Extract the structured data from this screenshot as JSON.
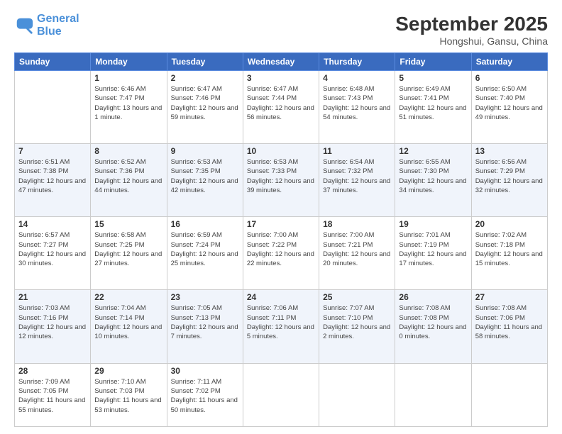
{
  "header": {
    "logo_line1": "General",
    "logo_line2": "Blue",
    "month": "September 2025",
    "location": "Hongshui, Gansu, China"
  },
  "weekdays": [
    "Sunday",
    "Monday",
    "Tuesday",
    "Wednesday",
    "Thursday",
    "Friday",
    "Saturday"
  ],
  "weeks": [
    [
      null,
      {
        "day": 1,
        "sunrise": "6:46 AM",
        "sunset": "7:47 PM",
        "daylight": "13 hours and 1 minute."
      },
      {
        "day": 2,
        "sunrise": "6:47 AM",
        "sunset": "7:46 PM",
        "daylight": "12 hours and 59 minutes."
      },
      {
        "day": 3,
        "sunrise": "6:47 AM",
        "sunset": "7:44 PM",
        "daylight": "12 hours and 56 minutes."
      },
      {
        "day": 4,
        "sunrise": "6:48 AM",
        "sunset": "7:43 PM",
        "daylight": "12 hours and 54 minutes."
      },
      {
        "day": 5,
        "sunrise": "6:49 AM",
        "sunset": "7:41 PM",
        "daylight": "12 hours and 51 minutes."
      },
      {
        "day": 6,
        "sunrise": "6:50 AM",
        "sunset": "7:40 PM",
        "daylight": "12 hours and 49 minutes."
      }
    ],
    [
      {
        "day": 7,
        "sunrise": "6:51 AM",
        "sunset": "7:38 PM",
        "daylight": "12 hours and 47 minutes."
      },
      {
        "day": 8,
        "sunrise": "6:52 AM",
        "sunset": "7:36 PM",
        "daylight": "12 hours and 44 minutes."
      },
      {
        "day": 9,
        "sunrise": "6:53 AM",
        "sunset": "7:35 PM",
        "daylight": "12 hours and 42 minutes."
      },
      {
        "day": 10,
        "sunrise": "6:53 AM",
        "sunset": "7:33 PM",
        "daylight": "12 hours and 39 minutes."
      },
      {
        "day": 11,
        "sunrise": "6:54 AM",
        "sunset": "7:32 PM",
        "daylight": "12 hours and 37 minutes."
      },
      {
        "day": 12,
        "sunrise": "6:55 AM",
        "sunset": "7:30 PM",
        "daylight": "12 hours and 34 minutes."
      },
      {
        "day": 13,
        "sunrise": "6:56 AM",
        "sunset": "7:29 PM",
        "daylight": "12 hours and 32 minutes."
      }
    ],
    [
      {
        "day": 14,
        "sunrise": "6:57 AM",
        "sunset": "7:27 PM",
        "daylight": "12 hours and 30 minutes."
      },
      {
        "day": 15,
        "sunrise": "6:58 AM",
        "sunset": "7:25 PM",
        "daylight": "12 hours and 27 minutes."
      },
      {
        "day": 16,
        "sunrise": "6:59 AM",
        "sunset": "7:24 PM",
        "daylight": "12 hours and 25 minutes."
      },
      {
        "day": 17,
        "sunrise": "7:00 AM",
        "sunset": "7:22 PM",
        "daylight": "12 hours and 22 minutes."
      },
      {
        "day": 18,
        "sunrise": "7:00 AM",
        "sunset": "7:21 PM",
        "daylight": "12 hours and 20 minutes."
      },
      {
        "day": 19,
        "sunrise": "7:01 AM",
        "sunset": "7:19 PM",
        "daylight": "12 hours and 17 minutes."
      },
      {
        "day": 20,
        "sunrise": "7:02 AM",
        "sunset": "7:18 PM",
        "daylight": "12 hours and 15 minutes."
      }
    ],
    [
      {
        "day": 21,
        "sunrise": "7:03 AM",
        "sunset": "7:16 PM",
        "daylight": "12 hours and 12 minutes."
      },
      {
        "day": 22,
        "sunrise": "7:04 AM",
        "sunset": "7:14 PM",
        "daylight": "12 hours and 10 minutes."
      },
      {
        "day": 23,
        "sunrise": "7:05 AM",
        "sunset": "7:13 PM",
        "daylight": "12 hours and 7 minutes."
      },
      {
        "day": 24,
        "sunrise": "7:06 AM",
        "sunset": "7:11 PM",
        "daylight": "12 hours and 5 minutes."
      },
      {
        "day": 25,
        "sunrise": "7:07 AM",
        "sunset": "7:10 PM",
        "daylight": "12 hours and 2 minutes."
      },
      {
        "day": 26,
        "sunrise": "7:08 AM",
        "sunset": "7:08 PM",
        "daylight": "12 hours and 0 minutes."
      },
      {
        "day": 27,
        "sunrise": "7:08 AM",
        "sunset": "7:06 PM",
        "daylight": "11 hours and 58 minutes."
      }
    ],
    [
      {
        "day": 28,
        "sunrise": "7:09 AM",
        "sunset": "7:05 PM",
        "daylight": "11 hours and 55 minutes."
      },
      {
        "day": 29,
        "sunrise": "7:10 AM",
        "sunset": "7:03 PM",
        "daylight": "11 hours and 53 minutes."
      },
      {
        "day": 30,
        "sunrise": "7:11 AM",
        "sunset": "7:02 PM",
        "daylight": "11 hours and 50 minutes."
      },
      null,
      null,
      null,
      null
    ]
  ]
}
